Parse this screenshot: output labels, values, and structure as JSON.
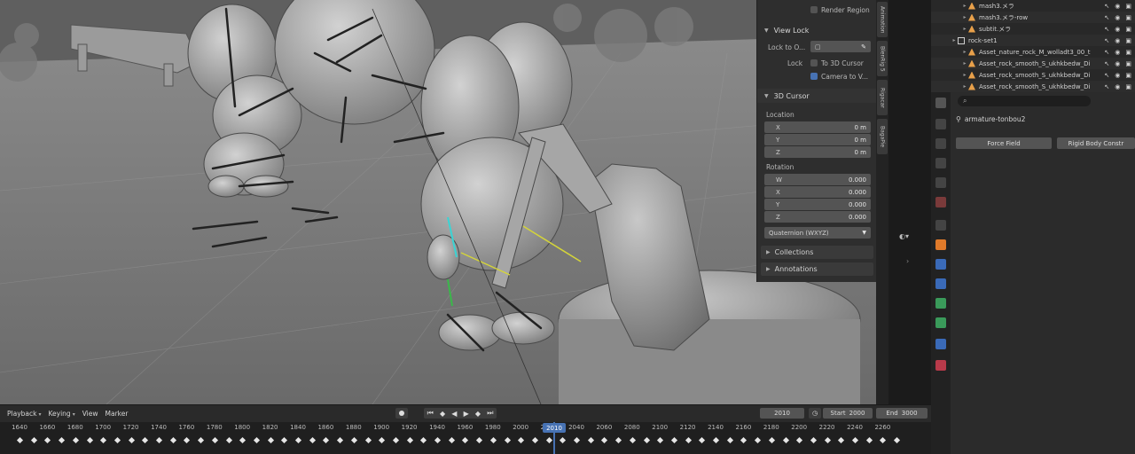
{
  "npanel": {
    "render_region_label": "Render Region",
    "view_lock": {
      "header": "View Lock",
      "lock_to_object_label": "Lock to O...",
      "lock_label": "Lock",
      "to_3d_cursor_label": "To 3D Cursor",
      "camera_to_view_label": "Camera to V..."
    },
    "cursor": {
      "header": "3D Cursor",
      "location_label": "Location",
      "location": [
        {
          "axis": "X",
          "value": "0 m"
        },
        {
          "axis": "Y",
          "value": "0 m"
        },
        {
          "axis": "Z",
          "value": "0 m"
        }
      ],
      "rotation_label": "Rotation",
      "rotation": [
        {
          "axis": "W",
          "value": "0.000"
        },
        {
          "axis": "X",
          "value": "0.000"
        },
        {
          "axis": "Y",
          "value": "0.000"
        },
        {
          "axis": "Z",
          "value": "0.000"
        }
      ],
      "mode": "Quaternion (WXYZ)"
    },
    "collections_label": "Collections",
    "annotations_label": "Annotations",
    "tabs": [
      "Animation",
      "BlenRig 5",
      "Rigacar",
      "BagaPie"
    ]
  },
  "outliner": {
    "rows": [
      {
        "name": "mash3.メラ",
        "indent": 2,
        "type": "mesh"
      },
      {
        "name": "mash3.メラ-row",
        "indent": 2,
        "type": "mesh"
      },
      {
        "name": "subtit.メラ",
        "indent": 2,
        "type": "mesh"
      },
      {
        "name": "rock-set1",
        "indent": 1,
        "type": "coll"
      },
      {
        "name": "Asset_nature_rock_M_wolladt3_00_t",
        "indent": 2,
        "type": "mesh"
      },
      {
        "name": "Asset_rock_smooth_S_ukhkbedw_Di",
        "indent": 2,
        "type": "mesh"
      },
      {
        "name": "Asset_rock_smooth_S_ukhkbedw_Di",
        "indent": 2,
        "type": "mesh"
      },
      {
        "name": "Asset_rock_smooth_S_ukhkbedw_Di",
        "indent": 2,
        "type": "mesh"
      }
    ]
  },
  "properties": {
    "object_name": "armature-tonbou2",
    "force_field_label": "Force Field",
    "rigid_body_label": "Rigid Body Constr"
  },
  "timeline": {
    "menus": [
      "Playback",
      "Keying",
      "View",
      "Marker"
    ],
    "current_frame": "2010",
    "start_label": "Start",
    "start": "2000",
    "end_label": "End",
    "end": "3000",
    "ticks": [
      "1640",
      "1660",
      "1680",
      "1700",
      "1720",
      "1740",
      "1760",
      "1780",
      "1800",
      "1820",
      "1840",
      "1860",
      "1880",
      "1900",
      "1920",
      "1940",
      "1960",
      "1980",
      "2000",
      "2020",
      "2040",
      "2060",
      "2080",
      "2100",
      "2120",
      "2140",
      "2160",
      "2180",
      "2200",
      "2220",
      "2240",
      "2260"
    ],
    "playhead_label": "2010"
  },
  "colors": {
    "accent": "#4772b3",
    "playhead": "#4772b3",
    "viewport_bg": "#6f6f6f"
  }
}
